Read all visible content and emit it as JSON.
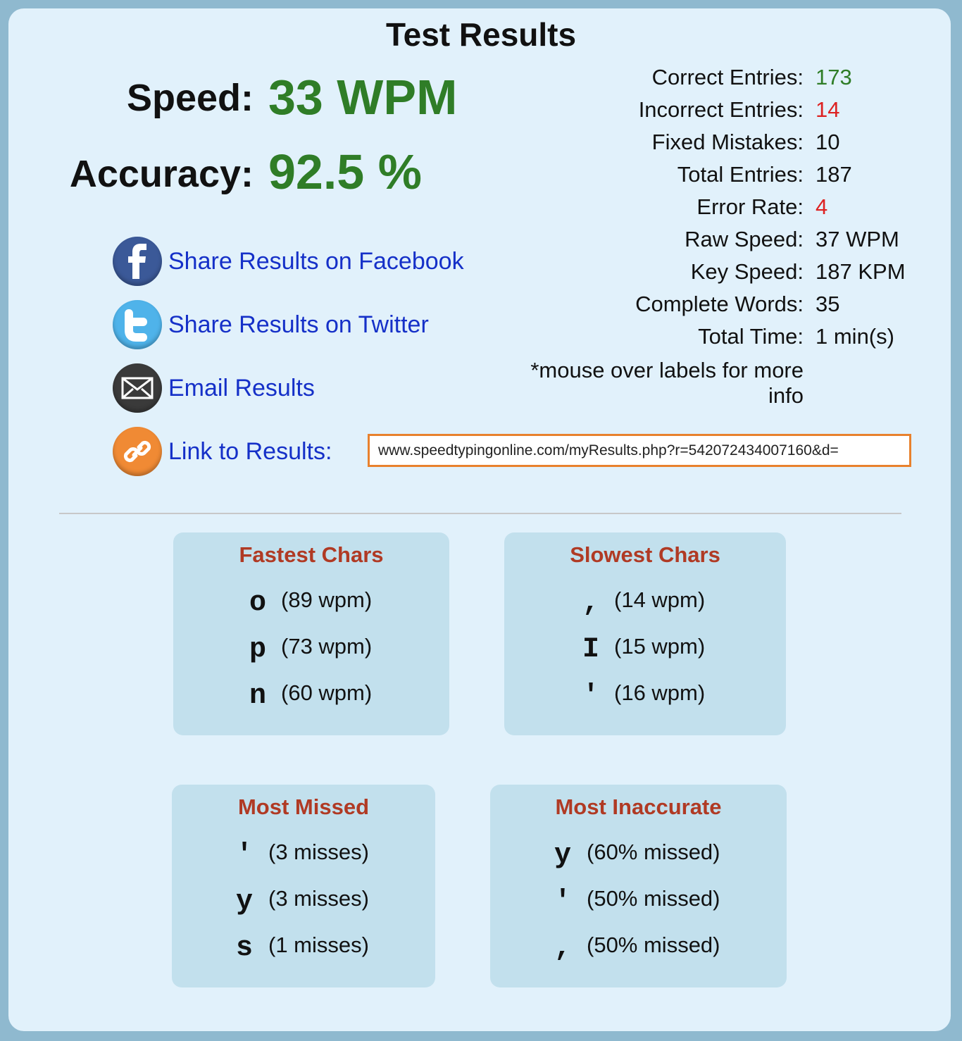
{
  "title": "Test Results",
  "speed": {
    "label": "Speed:",
    "value": "33 WPM"
  },
  "accuracy": {
    "label": "Accuracy:",
    "value": "92.5 %"
  },
  "share": {
    "facebook": "Share Results on Facebook",
    "twitter": "Share Results on Twitter",
    "email": "Email Results",
    "link": "Link to Results:"
  },
  "link_url": "www.speedtypingonline.com/myResults.php?r=542072434007160&d=",
  "stats": [
    {
      "label": "Correct Entries:",
      "value": "173",
      "color": "#2f7d27"
    },
    {
      "label": "Incorrect Entries:",
      "value": "14",
      "color": "#dd2222"
    },
    {
      "label": "Fixed Mistakes:",
      "value": "10"
    },
    {
      "label": "Total Entries:",
      "value": "187"
    },
    {
      "label": "Error Rate:",
      "value": "4",
      "color": "#dd2222"
    },
    {
      "label": "Raw Speed:",
      "value": "37 WPM"
    },
    {
      "label": "Key Speed:",
      "value": "187 KPM"
    },
    {
      "label": "Complete Words:",
      "value": "35"
    },
    {
      "label": "Total Time:",
      "value": "1 min(s)"
    }
  ],
  "hint": "*mouse over labels for more info",
  "boxes": {
    "fastest": {
      "title": "Fastest Chars",
      "items": [
        {
          "char": "o",
          "value": "(89 wpm)"
        },
        {
          "char": "p",
          "value": "(73 wpm)"
        },
        {
          "char": "n",
          "value": "(60 wpm)"
        }
      ]
    },
    "slowest": {
      "title": "Slowest Chars",
      "items": [
        {
          "char": ",",
          "value": "(14 wpm)"
        },
        {
          "char": "I",
          "value": "(15 wpm)"
        },
        {
          "char": "'",
          "value": "(16 wpm)"
        }
      ]
    },
    "missed": {
      "title": "Most Missed",
      "items": [
        {
          "char": "'",
          "value": "(3 misses)"
        },
        {
          "char": "y",
          "value": "(3 misses)"
        },
        {
          "char": "s",
          "value": "(1 misses)"
        }
      ]
    },
    "inaccurate": {
      "title": "Most Inaccurate",
      "items": [
        {
          "char": "y",
          "value": "(60% missed)"
        },
        {
          "char": "'",
          "value": "(50% missed)"
        },
        {
          "char": ",",
          "value": "(50% missed)"
        }
      ]
    }
  },
  "colors": {
    "accent_green": "#2f7d27",
    "error_red": "#dd2222",
    "link_blue": "#1530c8",
    "box_title": "#b03a24",
    "facebook": "#3b5998",
    "twitter": "#4fb3ea",
    "email": "#3a3a3a",
    "link_icon": "#f08a34"
  },
  "icons": {
    "facebook": "facebook-icon",
    "twitter": "twitter-icon",
    "email": "envelope-icon",
    "link": "chain-link-icon"
  }
}
